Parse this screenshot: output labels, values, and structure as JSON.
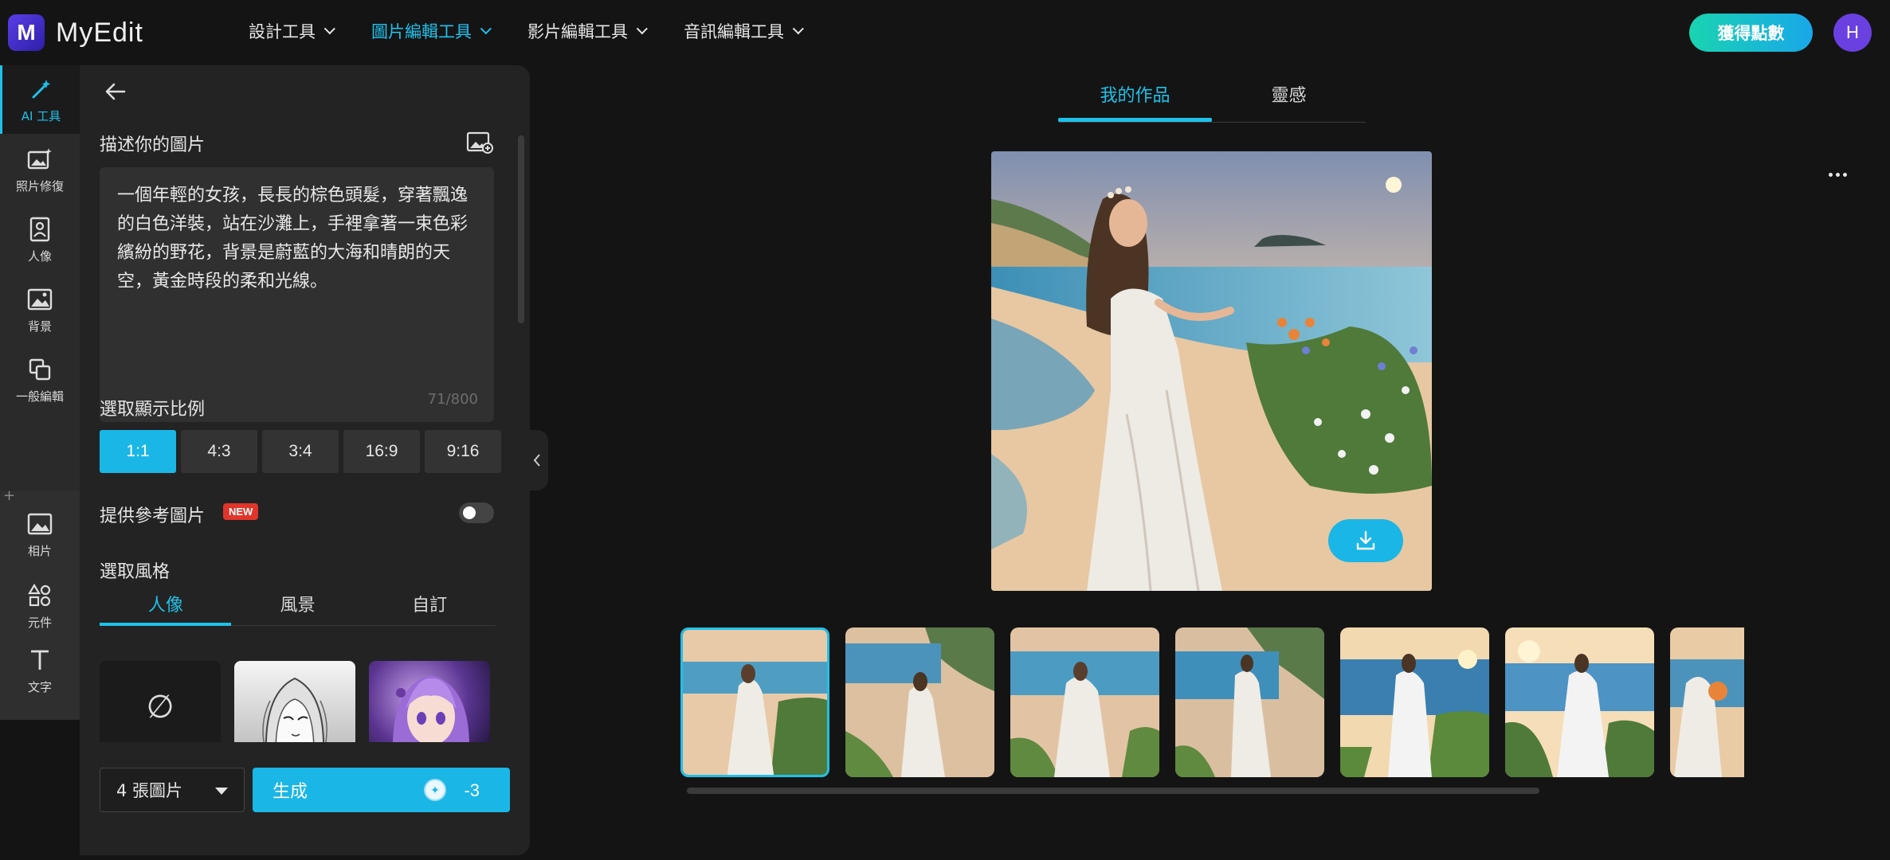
{
  "app": {
    "logo_letter": "M",
    "name": "MyEdit"
  },
  "nav": [
    {
      "label": "設計工具",
      "active": false
    },
    {
      "label": "圖片編輯工具",
      "active": true
    },
    {
      "label": "影片編輯工具",
      "active": false
    },
    {
      "label": "音訊編輯工具",
      "active": false
    }
  ],
  "header": {
    "points_label": "獲得點數",
    "avatar_letter": "H"
  },
  "rail": [
    {
      "label": "AI 工具",
      "icon": "magic-wand-icon",
      "active": true
    },
    {
      "label": "照片修復",
      "icon": "photo-repair-icon",
      "active": false
    },
    {
      "label": "人像",
      "icon": "portrait-icon",
      "active": false
    },
    {
      "label": "背景",
      "icon": "background-icon",
      "active": false
    },
    {
      "label": "一般編輯",
      "icon": "edit-layers-icon",
      "active": false
    },
    {
      "label": "相片",
      "icon": "photo-icon",
      "active": false
    },
    {
      "label": "元件",
      "icon": "shapes-icon",
      "active": false
    },
    {
      "label": "文字",
      "icon": "text-icon",
      "active": false
    }
  ],
  "rail_plus": "+",
  "panel": {
    "describe_title": "描述你的圖片",
    "prompt_text": "一個年輕的女孩，長長的棕色頭髮，穿著飄逸的白色洋裝，站在沙灘上，手裡拿著一束色彩繽紛的野花，背景是蔚藍的大海和晴朗的天空，黃金時段的柔和光線。",
    "char_count": "71/800",
    "ratio_title": "選取顯示比例",
    "ratios": [
      "1:1",
      "4:3",
      "3:4",
      "16:9",
      "9:16"
    ],
    "ratio_selected": "1:1",
    "reference_title": "提供參考圖片",
    "new_badge": "NEW",
    "reference_enabled": false,
    "style_title": "選取風格",
    "style_tabs": [
      "人像",
      "風景",
      "自訂"
    ],
    "style_tab_selected": "人像",
    "none_symbol": "∅",
    "count_value": "4 張圖片",
    "generate_label": "生成",
    "generate_cost": "-3"
  },
  "main": {
    "tabs": [
      "我的作品",
      "靈感"
    ],
    "tab_selected": "我的作品",
    "thumbnail_count": 7,
    "selected_thumbnail": 0
  },
  "colors": {
    "accent": "#1fc1ea",
    "button": "#1ab6e6",
    "badge": "#e0352b",
    "avatar": "#6a40e0"
  }
}
